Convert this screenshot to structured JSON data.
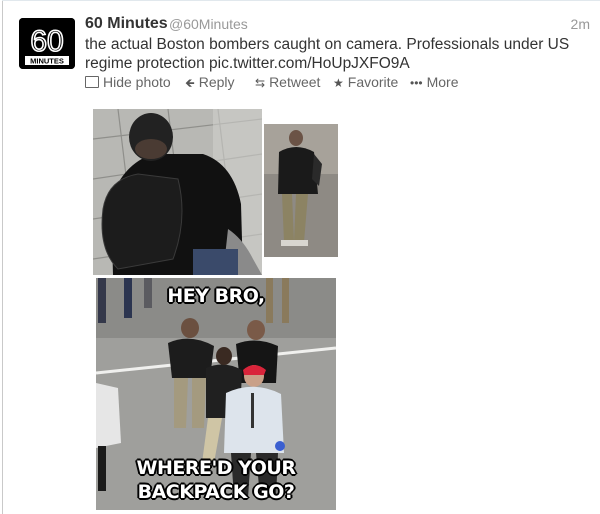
{
  "tweet": {
    "display_name": "60 Minutes",
    "handle": "@60Minutes",
    "time": "2m",
    "avatar_text": [
      "60",
      "MINUTES"
    ],
    "text": "the actual Boston bombers caught on camera. Professionals under US regime protection pic.twitter.com/HoUpJXFO9A"
  },
  "actions": {
    "hide_photo": "Hide photo",
    "reply": "Reply",
    "retweet": "Retweet",
    "favorite": "Favorite",
    "more": "More"
  },
  "icons": {
    "hide_photo": "photo-icon",
    "reply": "reply-arrow-icon",
    "retweet": "retweet-icon",
    "favorite": "star-icon",
    "more": "dots-icon"
  },
  "meme": {
    "top_text": "HEY BRO,",
    "bottom_line1": "WHERE'D YOUR",
    "bottom_line2": "BACKPACK GO?"
  },
  "colors": {
    "name": "#333333",
    "secondary": "#999999",
    "action": "#666666"
  }
}
